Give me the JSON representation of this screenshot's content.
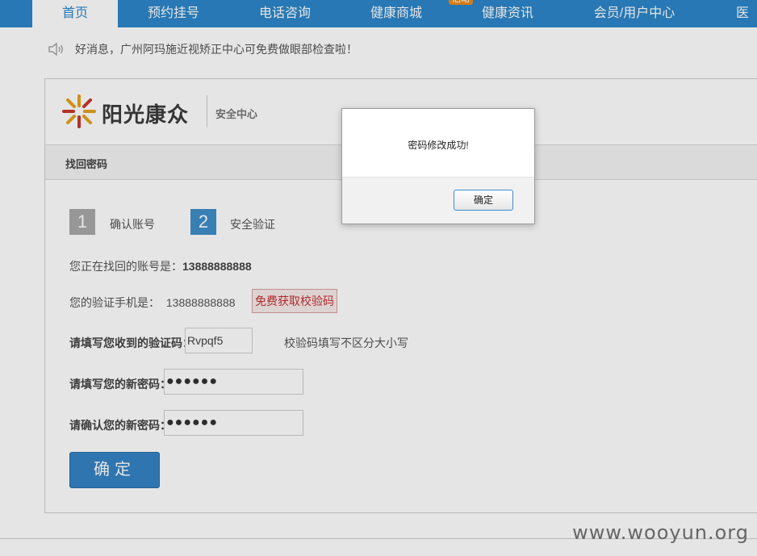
{
  "nav": {
    "items": [
      {
        "label": "首页",
        "active": true
      },
      {
        "label": "预约挂号"
      },
      {
        "label": "电话咨询"
      },
      {
        "label": "健康商城",
        "badge": "活动"
      },
      {
        "label": "健康资讯"
      },
      {
        "label": "会员/用户中心"
      },
      {
        "label": "医疗"
      }
    ]
  },
  "notice": {
    "icon": "speaker-icon",
    "text": "好消息，广州阿玛施近视矫正中心可免费做眼部检查啦！"
  },
  "header": {
    "logo_text": "阳光康众",
    "logo_icon": "sun-icon",
    "section": "安全中心"
  },
  "form": {
    "section_title": "找回密码",
    "steps": [
      {
        "number": "1",
        "label": "确认账号",
        "state": "done"
      },
      {
        "number": "2",
        "label": "安全验证",
        "state": "current"
      }
    ],
    "account_label": "您正在找回的账号是：",
    "account_value": "13888888888",
    "phone_label": "您的验证手机是：",
    "phone_value": "13888888888",
    "get_code_button": "免费获取校验码",
    "code_label": "请填写您收到的验证码：",
    "code_value": "Rvpqf5",
    "code_hint": "校验码填写不区分大小写",
    "new_password_label": "请填写您的新密码：",
    "new_password_mask": "●●●●●●",
    "confirm_password_label": "请确认您的新密码：",
    "confirm_password_mask": "●●●●●●",
    "submit_button": "确定"
  },
  "dialog": {
    "message": "密码修改成功!",
    "ok_button": "确定"
  },
  "watermark": "www.wooyun.org",
  "colors": {
    "nav_bg": "#2c86c9",
    "step_done": "#a9a9a9",
    "step_current": "#3f8ec9",
    "primary_button": "#3583c4",
    "get_code_text": "#c52f2f"
  }
}
